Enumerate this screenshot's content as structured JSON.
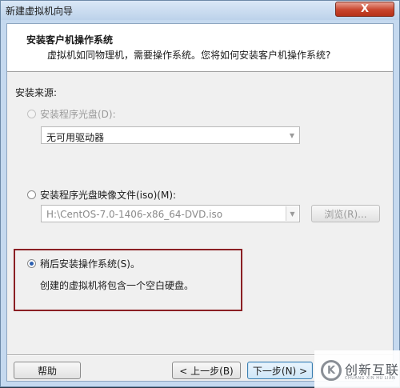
{
  "window": {
    "title": "新建虚拟机向导",
    "close_label": "X"
  },
  "header": {
    "title": "安装客户机操作系统",
    "subtitle": "虚拟机如同物理机，需要操作系统。您将如何安装客户机操作系统?"
  },
  "source": {
    "label": "安装来源:",
    "disc": {
      "label": "安装程序光盘(D):",
      "selected": false,
      "enabled": false,
      "drive_value": "无可用驱动器"
    },
    "iso": {
      "label": "安装程序光盘映像文件(iso)(M):",
      "selected": false,
      "enabled": true,
      "path_value": "H:\\CentOS-7.0-1406-x86_64-DVD.iso",
      "browse_label": "浏览(R)..."
    },
    "later": {
      "label": "稍后安装操作系统(S)。",
      "selected": true,
      "description": "创建的虚拟机将包含一个空白硬盘。"
    }
  },
  "footer": {
    "help_label": "帮助",
    "back_label": "< 上一步(B)",
    "next_label": "下一步(N) >"
  },
  "watermark": {
    "text": "创新互联",
    "sub": "CHUANG XIN HU LIAN",
    "logo_glyph": "K"
  },
  "colors": {
    "highlight": "#8b1f24",
    "accent": "#2b5fb0"
  }
}
